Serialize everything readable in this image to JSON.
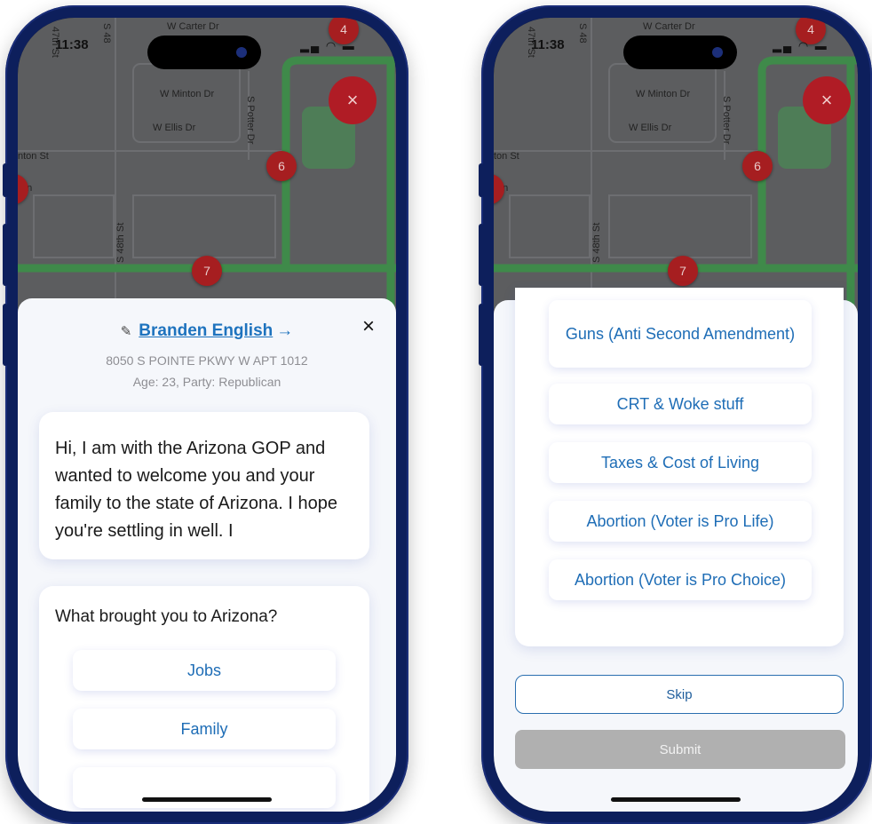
{
  "left": {
    "status_time": "11:38",
    "streets": [
      "W Carter Dr",
      "47th St",
      "S 48",
      "W Minton Dr",
      "W Ellis Dr",
      "S Potter Dr",
      "nton St",
      "Ln",
      "S 48th St"
    ],
    "markers": [
      "4",
      "6",
      "7"
    ],
    "close_icon": "×",
    "contact": {
      "edit_icon": "edit-pencil-icon",
      "name": "Branden English",
      "arrow": "→",
      "close": "×",
      "address": "8050 S POINTE PKWY W APT 1012",
      "age_party": "Age: 23, Party: Republican"
    },
    "message": "Hi, I am with the Arizona GOP and wanted to welcome you and your family to the state of Arizona. I hope you're settling in well. I",
    "question": "What brought you to Arizona?",
    "options": [
      "Jobs",
      "Family"
    ]
  },
  "right": {
    "status_time": "11:38",
    "streets": [
      "W Carter Dr",
      "47th St",
      "S 48",
      "W Minton Dr",
      "W Ellis Dr",
      "S Potter Dr",
      "ton St",
      "Ln",
      "S 48th St"
    ],
    "markers": [
      "4",
      "6",
      "7"
    ],
    "close_icon": "×",
    "options": [
      "Guns (Anti Second Amendment)",
      "CRT & Woke stuff",
      "Taxes & Cost of Living",
      "Abortion (Voter is Pro Life)",
      "Abortion (Voter is Pro Choice)"
    ],
    "skip": "Skip",
    "submit": "Submit"
  },
  "colors": {
    "frame": "#0d1f5c",
    "accent": "#1e73be",
    "marker": "#a61e20",
    "route": "#3f8a4a"
  }
}
